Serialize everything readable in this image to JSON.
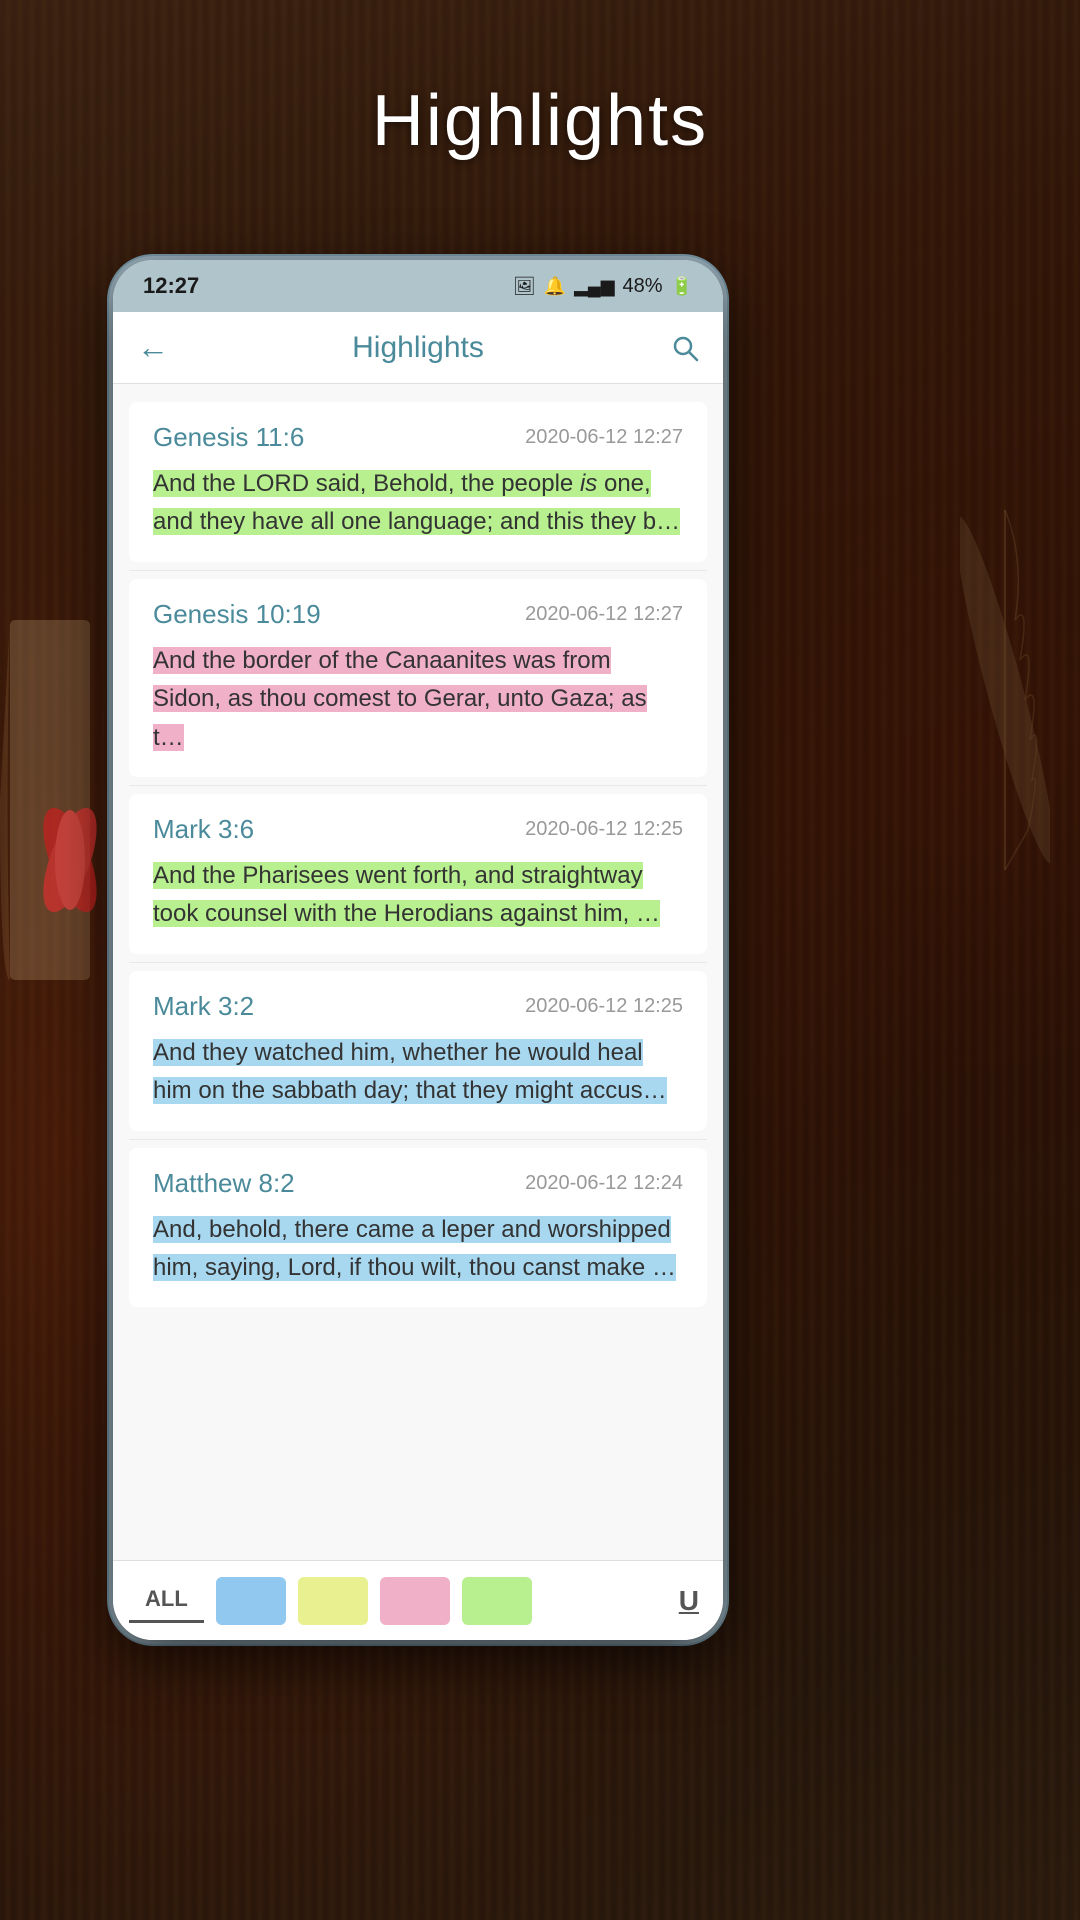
{
  "page": {
    "title": "Highlights",
    "background_color": "#2a1508"
  },
  "status_bar": {
    "time": "12:27",
    "battery": "48%",
    "signal": "▂▄▆"
  },
  "header": {
    "back_label": "←",
    "title": "Highlights",
    "search_icon": "🔍"
  },
  "highlights": [
    {
      "reference": "Genesis 11:6",
      "date": "2020-06-12 12:27",
      "text": "And the LORD said, Behold, the people is one, and they have all one language; and this they b…",
      "highlight_color": "green"
    },
    {
      "reference": "Genesis 10:19",
      "date": "2020-06-12 12:27",
      "text": "And the border of the Canaanites was from Sidon, as thou comest to Gerar, unto Gaza; as t…",
      "highlight_color": "pink"
    },
    {
      "reference": "Mark 3:6",
      "date": "2020-06-12 12:25",
      "text": "And the Pharisees went forth, and straightway took counsel with the Herodians against him, …",
      "highlight_color": "green"
    },
    {
      "reference": "Mark 3:2",
      "date": "2020-06-12 12:25",
      "text": "And they watched him, whether he would heal him on the sabbath day; that they might accus…",
      "highlight_color": "blue"
    },
    {
      "reference": "Matthew 8:2",
      "date": "2020-06-12 12:24",
      "text": "And, behold, there came a leper and worshipped him, saying, Lord, if thou wilt, thou canst make …",
      "highlight_color": "blue"
    }
  ],
  "bottom_bar": {
    "all_label": "ALL",
    "colors": [
      "#90c8f0",
      "#e8f090",
      "#f0b0c8",
      "#b8f090"
    ],
    "underline_label": "U"
  }
}
